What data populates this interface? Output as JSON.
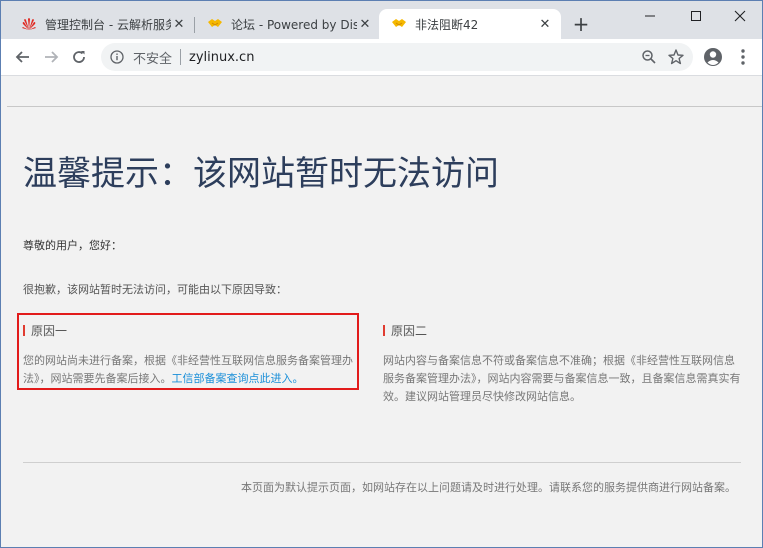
{
  "tabs": [
    {
      "title": "管理控制台 - 云解析服务DNS",
      "icon": "huawei-logo-icon"
    },
    {
      "title": "论坛 - Powered by Discuz!",
      "icon": "handshake-icon"
    },
    {
      "title": "非法阻断42",
      "icon": "handshake-icon",
      "active": true
    }
  ],
  "toolbar": {
    "security_label": "不安全",
    "url": "zylinux.cn"
  },
  "page": {
    "headline": "温馨提示：该网站暂时无法访问",
    "greeting": "尊敬的用户，您好：",
    "sorry": "很抱歉，该网站暂时无法访问，可能由以下原因导致：",
    "reason1": {
      "title": "原因一",
      "body": "您的网站尚未进行备案，根据《非经营性互联网信息服务备案管理办法》，网站需要先备案后接入。",
      "link": "工信部备案查询点此进入。"
    },
    "reason2": {
      "title": "原因二",
      "body": "网站内容与备案信息不符或备案信息不准确；根据《非经营性互联网信息服务备案管理办法》，网站内容需要与备案信息一致，且备案信息需真实有效。建议网站管理员尽快修改网站信息。"
    },
    "footer": "本页面为默认提示页面，如网站存在以上问题请及时进行处理。请联系您的服务提供商进行网站备案。"
  },
  "colors": {
    "accent_red": "#e03c31",
    "link_blue": "#1a8fd8",
    "headline": "#2d3e5c"
  }
}
